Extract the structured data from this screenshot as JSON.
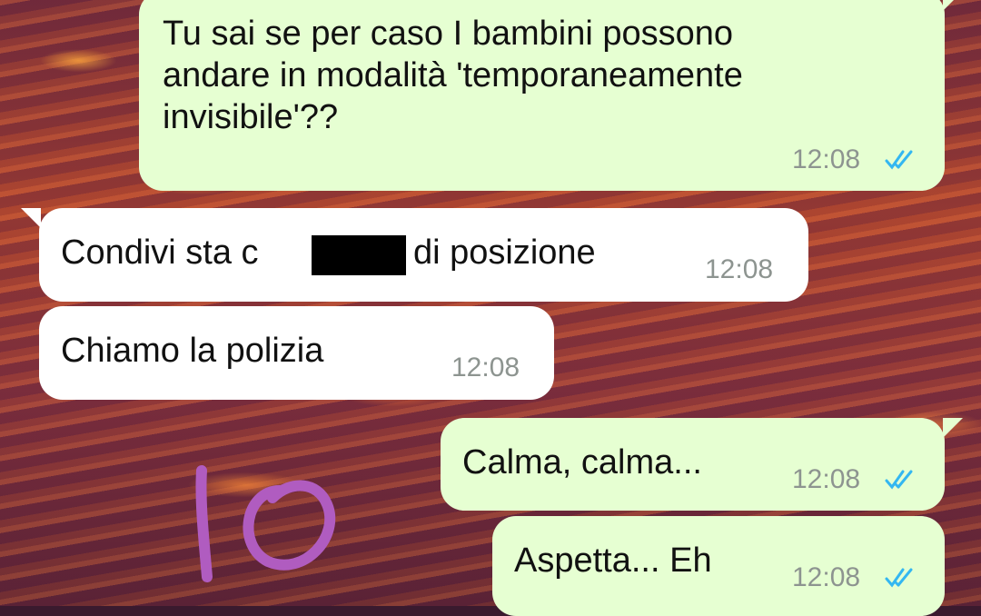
{
  "messages": [
    {
      "text": "Tu sai se per caso I bambini possono\nandare in modalità 'temporaneamente\ninvisibile'??",
      "time": "12:08"
    },
    {
      "text_before": "Condivi sta c",
      "text_after": "di posizione",
      "time": "12:08"
    },
    {
      "text": "Chiamo la polizia",
      "time": "12:08"
    },
    {
      "text": "Calma, calma...",
      "time": "12:08"
    },
    {
      "text": "Aspetta... Eh",
      "time": "12:08"
    }
  ],
  "colors": {
    "outgoing_bubble": "#e6ffd2",
    "incoming_bubble": "#ffffff",
    "read_ticks": "#34b7f1",
    "doodle": "#b05cc0"
  },
  "icons": {
    "read_receipt": "double-check-icon"
  },
  "doodle_text": "10"
}
